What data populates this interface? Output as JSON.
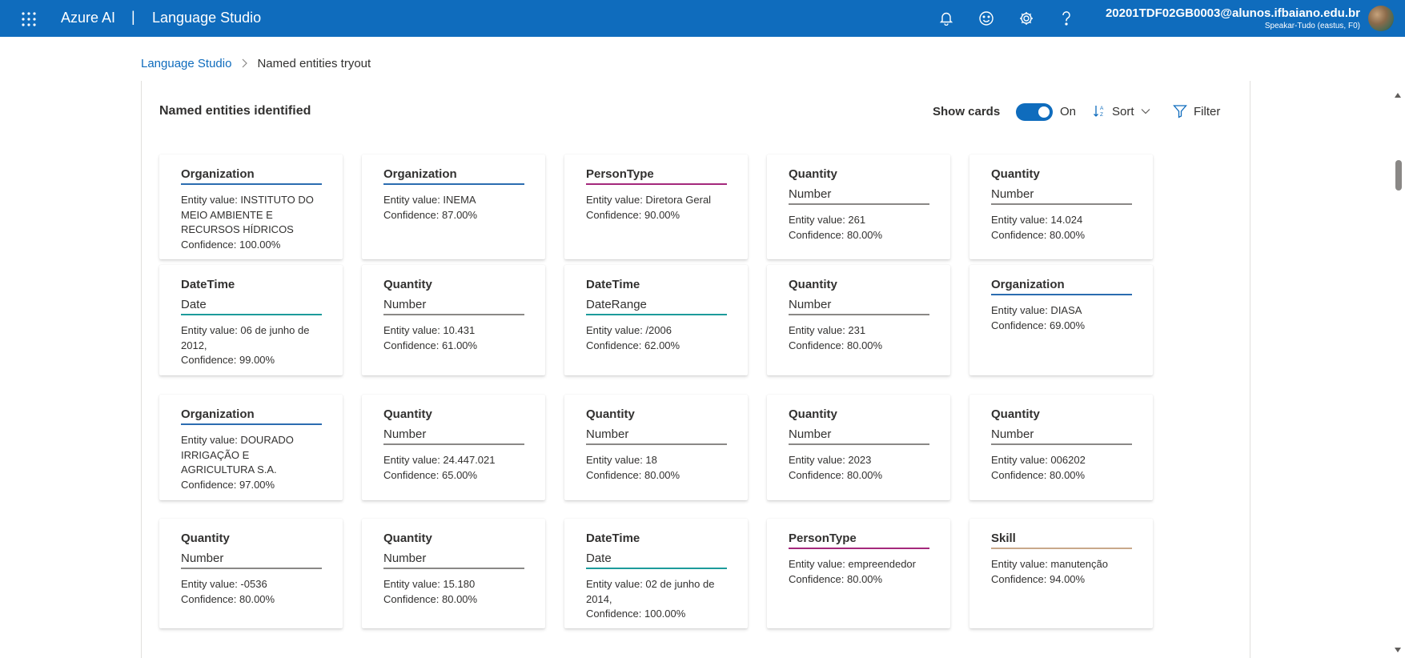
{
  "topbar": {
    "brand": "Azure AI",
    "separator": "|",
    "product": "Language Studio",
    "icons": [
      "notifications-icon",
      "feedback-smile-icon",
      "settings-gear-icon",
      "help-icon"
    ],
    "account_email": "20201TDF02GB0003@alunos.ifbaiano.edu.br",
    "account_sub": "Speakar-Tudo (eastus, F0)",
    "background": "#0f6cbd"
  },
  "breadcrumb": {
    "root": "Language Studio",
    "current": "Named entities tryout"
  },
  "panel": {
    "title": "Named entities identified",
    "show_cards_label": "Show cards",
    "toggle_state": "On",
    "sort_label": "Sort",
    "filter_label": "Filter"
  },
  "category_colors": {
    "Organization": "#2b6cb0",
    "PersonType": "#a4287c",
    "Quantity": "#8a8886",
    "DateTime": "#1d9b9b",
    "Skill": "#c8a88a"
  },
  "cards": [
    {
      "category": "Organization",
      "subcategory": "",
      "value": "Entity value: INSTITUTO DO MEIO AMBIENTE E RECURSOS HÍDRICOS",
      "confidence": "Confidence: 100.00%"
    },
    {
      "category": "Organization",
      "subcategory": "",
      "value": "Entity value: INEMA",
      "confidence": "Confidence: 87.00%"
    },
    {
      "category": "PersonType",
      "subcategory": "",
      "value": "Entity value: Diretora Geral",
      "confidence": "Confidence: 90.00%"
    },
    {
      "category": "Quantity",
      "subcategory": "Number",
      "value": "Entity value: 261",
      "confidence": "Confidence: 80.00%"
    },
    {
      "category": "Quantity",
      "subcategory": "Number",
      "value": "Entity value: 14.024",
      "confidence": "Confidence: 80.00%"
    },
    {
      "category": "DateTime",
      "subcategory": "Date",
      "value": "Entity value: 06 de junho de 2012,",
      "confidence": "Confidence: 99.00%"
    },
    {
      "category": "Quantity",
      "subcategory": "Number",
      "value": "Entity value: 10.431",
      "confidence": "Confidence: 61.00%"
    },
    {
      "category": "DateTime",
      "subcategory": "DateRange",
      "value": "Entity value: /2006",
      "confidence": "Confidence: 62.00%"
    },
    {
      "category": "Quantity",
      "subcategory": "Number",
      "value": "Entity value: 231",
      "confidence": "Confidence: 80.00%"
    },
    {
      "category": "Organization",
      "subcategory": "",
      "value": "Entity value: DIASA",
      "confidence": "Confidence: 69.00%"
    },
    {
      "category": "Organization",
      "subcategory": "",
      "value": "Entity value: DOURADO IRRIGAÇÃO E AGRICULTURA S.A.",
      "confidence": "Confidence: 97.00%"
    },
    {
      "category": "Quantity",
      "subcategory": "Number",
      "value": "Entity value: 24.447.021",
      "confidence": "Confidence: 65.00%"
    },
    {
      "category": "Quantity",
      "subcategory": "Number",
      "value": "Entity value: 18",
      "confidence": "Confidence: 80.00%"
    },
    {
      "category": "Quantity",
      "subcategory": "Number",
      "value": "Entity value: 2023",
      "confidence": "Confidence: 80.00%"
    },
    {
      "category": "Quantity",
      "subcategory": "Number",
      "value": "Entity value: 006202",
      "confidence": "Confidence: 80.00%"
    },
    {
      "category": "Quantity",
      "subcategory": "Number",
      "value": "Entity value: -0536",
      "confidence": "Confidence: 80.00%"
    },
    {
      "category": "Quantity",
      "subcategory": "Number",
      "value": "Entity value: 15.180",
      "confidence": "Confidence: 80.00%"
    },
    {
      "category": "DateTime",
      "subcategory": "Date",
      "value": "Entity value: 02 de junho de 2014,",
      "confidence": "Confidence: 100.00%"
    },
    {
      "category": "PersonType",
      "subcategory": "",
      "value": "Entity value: empreendedor",
      "confidence": "Confidence: 80.00%"
    },
    {
      "category": "Skill",
      "subcategory": "",
      "value": "Entity value: manutenção",
      "confidence": "Confidence: 94.00%"
    }
  ]
}
